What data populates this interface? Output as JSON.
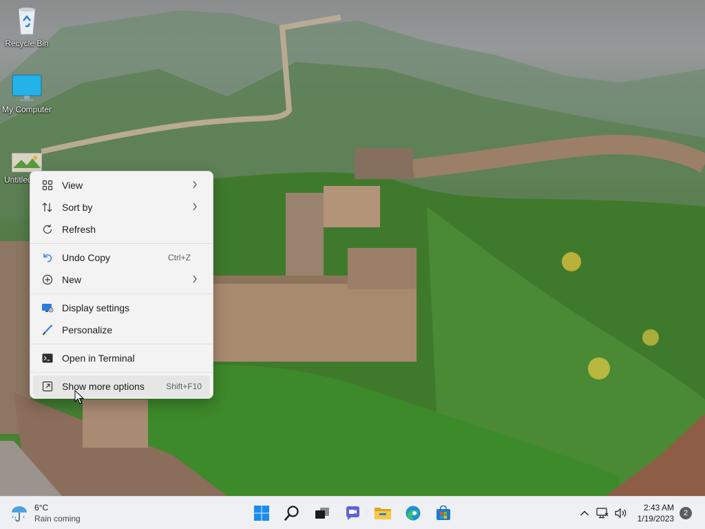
{
  "desktop": {
    "icons": [
      {
        "label": "Recycle Bin",
        "icon": "recycle-bin-icon"
      },
      {
        "label": "My Computer",
        "icon": "monitor-icon"
      },
      {
        "label": "Untitled",
        "icon": "image-file-icon"
      }
    ]
  },
  "context_menu": {
    "groups": [
      [
        {
          "label": "View",
          "icon": "grid-icon",
          "submenu": true
        },
        {
          "label": "Sort by",
          "icon": "sort-icon",
          "submenu": true
        },
        {
          "label": "Refresh",
          "icon": "refresh-icon"
        }
      ],
      [
        {
          "label": "Undo Copy",
          "icon": "undo-icon",
          "shortcut": "Ctrl+Z"
        },
        {
          "label": "New",
          "icon": "plus-circle-icon",
          "submenu": true
        }
      ],
      [
        {
          "label": "Display settings",
          "icon": "display-settings-icon"
        },
        {
          "label": "Personalize",
          "icon": "brush-icon"
        }
      ],
      [
        {
          "label": "Open in Terminal",
          "icon": "terminal-icon"
        }
      ],
      [
        {
          "label": "Show more options",
          "icon": "expand-icon",
          "shortcut": "Shift+F10",
          "hovered": true
        }
      ]
    ]
  },
  "taskbar": {
    "weather": {
      "temp": "6°C",
      "condition": "Rain coming"
    },
    "apps": [
      "start-icon",
      "search-icon",
      "task-view-icon",
      "chat-icon",
      "file-explorer-icon",
      "edge-icon",
      "store-icon"
    ],
    "clock": {
      "time": "2:43 AM",
      "date": "1/19/2023"
    },
    "notification_count": "2"
  },
  "colors": {
    "accent": "#0078d4",
    "menu_bg": "#f3f3f3",
    "taskbar_bg": "#eef0f3"
  }
}
